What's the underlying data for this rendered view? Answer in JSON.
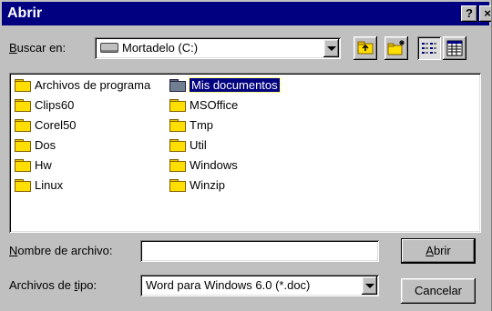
{
  "window": {
    "title": "Abrir",
    "help_label": "?",
    "close_label": "×"
  },
  "lookin": {
    "label_prefix": "",
    "label_underlined": "B",
    "label_rest": "uscar en:",
    "value": "Mortadelo (C:)"
  },
  "toolbar": {
    "up_icon": "folder-up-icon",
    "new_folder_icon": "new-folder-icon",
    "list_view_icon": "list-view-icon",
    "details_view_icon": "details-view-icon"
  },
  "files": {
    "col1": [
      "Archivos de programa",
      "Clips60",
      "Corel50",
      "Dos",
      "Hw",
      "Linux"
    ],
    "col2": [
      "Mis documentos",
      "MSOffice",
      "Tmp",
      "Util",
      "Windows",
      "Winzip"
    ],
    "selected": "Mis documentos"
  },
  "filename": {
    "label_underlined": "N",
    "label_rest": "ombre de archivo:",
    "value": ""
  },
  "filetype": {
    "label_prefix": "Archivos de ",
    "label_underlined": "t",
    "label_rest": "ipo:",
    "value": "Word para Windows 6.0 (*.doc)"
  },
  "buttons": {
    "open_underlined": "A",
    "open_rest": "brir",
    "cancel": "Cancelar"
  }
}
